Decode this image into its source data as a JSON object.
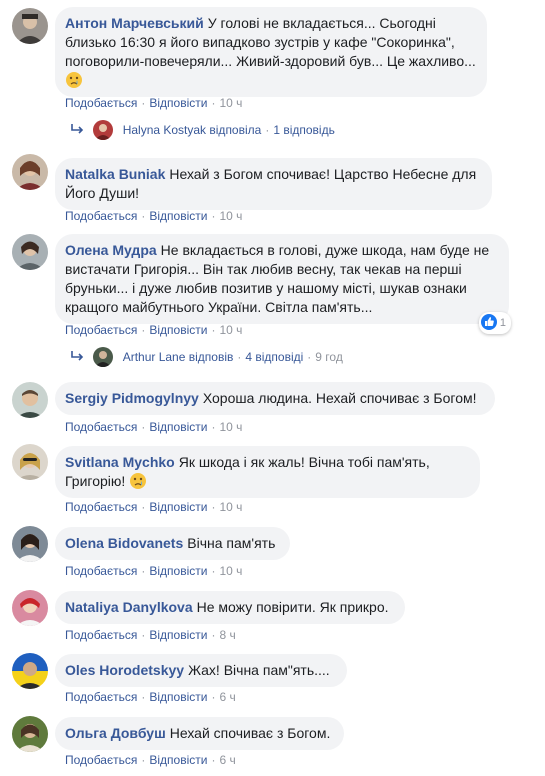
{
  "comments": [
    {
      "author": "Антон Марчевський",
      "text": "У голові не вкладається... Сьогодні близько 16:30 я його випадково зустрів у кафе \"Сокоринка\", поговорили-повечеряли... Живий-здоровий був... Це жахливо...",
      "like": "Подобається",
      "reply": "Відповісти",
      "time": "10 ч",
      "reply_preview": {
        "name": "Halyna Kostyak відповіла",
        "count": "1 відповідь",
        "time": ""
      }
    },
    {
      "author": "Natalka Buniak",
      "text": "Нехай з Богом спочиває! Царство Небесне для Його Души!",
      "like": "Подобається",
      "reply": "Відповісти",
      "time": "10 ч"
    },
    {
      "author": "Олена Мудра",
      "text": "Не вкладається в голові, дуже шкода, нам буде не вистачати Григорія... Він так любив весну, так чекав на перші бруньки... і дуже любив позитив у нашому місті, шукав ознаки кращого майбутнього України. Світла пам'ять...",
      "like": "Подобається",
      "reply": "Відповісти",
      "time": "10 ч",
      "reactions": "1",
      "reply_preview": {
        "name": "Arthur Lane відповів",
        "count": "4 відповіді",
        "time": "9 год"
      }
    },
    {
      "author": "Sergiy Pidmogylnyy",
      "text": "Хороша людина. Нехай спочиває з Богом!",
      "like": "Подобається",
      "reply": "Відповісти",
      "time": "10 ч"
    },
    {
      "author": "Svitlana Mychko",
      "text": "Як шкода і як жаль! Вічна тобі пам'ять, Григорію!",
      "like": "Подобається",
      "reply": "Відповісти",
      "time": "10 ч"
    },
    {
      "author": "Olena Bidovanets",
      "text": "Вічна пам'ять",
      "like": "Подобається",
      "reply": "Відповісти",
      "time": "10 ч"
    },
    {
      "author": "Nataliya Danylkova",
      "text": "Не можу повірити. Як прикро.",
      "like": "Подобається",
      "reply": "Відповісти",
      "time": "8 ч"
    },
    {
      "author": "Oles Horodetskyy",
      "text": "Жах! Вічна пам\"ять....",
      "like": "Подобається",
      "reply": "Відповісти",
      "time": "6 ч"
    },
    {
      "author": "Ольга Довбуш",
      "text": "Нехай спочиває з Богом.",
      "like": "Подобається",
      "reply": "Відповісти",
      "time": "6 ч"
    }
  ],
  "icons": {
    "reply_arrow": "reply-arrow-icon",
    "like": "like-icon",
    "emoji_cry": "crying-face-emoji"
  },
  "colors": {
    "link": "#385898",
    "meta": "#90949c",
    "bubble": "#f2f3f5",
    "like_blue": "#1877f2"
  }
}
